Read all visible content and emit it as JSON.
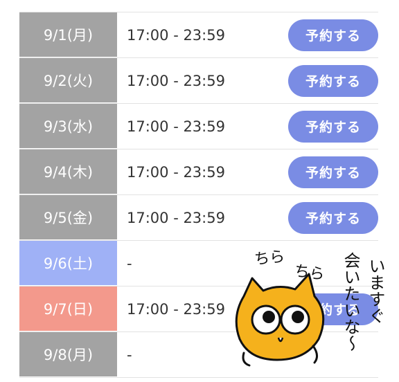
{
  "schedule": [
    {
      "date": "9/1(月)",
      "time": "17:00 - 23:59",
      "button": "予約する",
      "kind": "weekday"
    },
    {
      "date": "9/2(火)",
      "time": "17:00 - 23:59",
      "button": "予約する",
      "kind": "weekday"
    },
    {
      "date": "9/3(水)",
      "time": "17:00 - 23:59",
      "button": "予約する",
      "kind": "weekday"
    },
    {
      "date": "9/4(木)",
      "time": "17:00 - 23:59",
      "button": "予約する",
      "kind": "weekday"
    },
    {
      "date": "9/5(金)",
      "time": "17:00 - 23:59",
      "button": "予約する",
      "kind": "weekday"
    },
    {
      "date": "9/6(土)",
      "time": "-",
      "button": "",
      "kind": "saturday"
    },
    {
      "date": "9/7(日)",
      "time": "17:00 - 23:59",
      "button": "予約する",
      "kind": "sunday"
    },
    {
      "date": "9/8(月)",
      "time": "-",
      "button": "",
      "kind": "weekday"
    }
  ],
  "sticker": {
    "chira1": "ちら",
    "chira2": "ちら",
    "message_col1": "いますぐ",
    "message_col2": "会いたいな〜"
  },
  "colors": {
    "weekday": "#a3a3a3",
    "saturday": "#9fb1f6",
    "sunday": "#f3998c",
    "button": "#7a8ce4",
    "character": "#f5b11c"
  }
}
